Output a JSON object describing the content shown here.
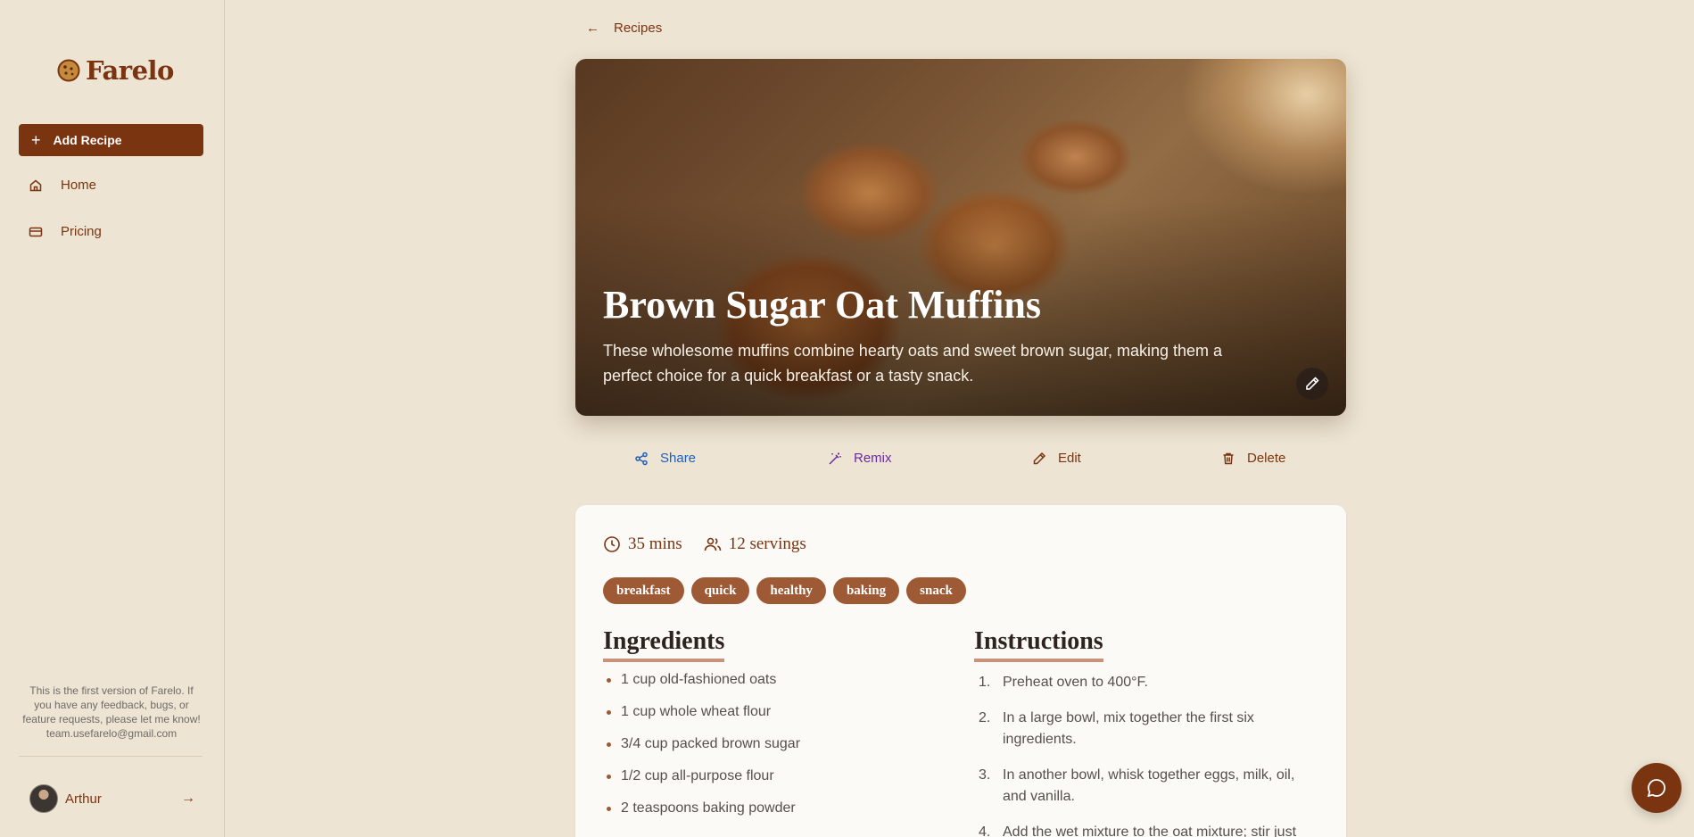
{
  "app": {
    "name": "Farelo"
  },
  "sidebar": {
    "add_recipe_label": "Add Recipe",
    "items": [
      {
        "label": "Home",
        "icon": "home-icon"
      },
      {
        "label": "Pricing",
        "icon": "credit-card-icon"
      }
    ],
    "feedback_text": "This is the first version of Farelo. If you have any feedback, bugs, or feature requests, please let me know! team.usefarelo@gmail.com",
    "user": {
      "name": "Arthur"
    }
  },
  "breadcrumb": {
    "back_label": "Recipes"
  },
  "recipe": {
    "title": "Brown Sugar Oat Muffins",
    "description": "These wholesome muffins combine hearty oats and sweet brown sugar, making them a perfect choice for a quick breakfast or a tasty snack.",
    "time": "35 mins",
    "servings": "12 servings",
    "tags": [
      "breakfast",
      "quick",
      "healthy",
      "baking",
      "snack"
    ],
    "ingredients_heading": "Ingredients",
    "instructions_heading": "Instructions",
    "ingredients": [
      "1 cup old-fashioned oats",
      "1 cup whole wheat flour",
      "3/4 cup packed brown sugar",
      "1/2 cup all-purpose flour",
      "2 teaspoons baking powder"
    ],
    "instructions": [
      {
        "num": "1.",
        "text": "Preheat oven to 400°F."
      },
      {
        "num": "2.",
        "text": "In a large bowl, mix together the first six ingredients."
      },
      {
        "num": "3.",
        "text": "In another bowl, whisk together eggs, milk, oil, and vanilla."
      },
      {
        "num": "4.",
        "text": "Add the wet mixture to the oat mixture; stir just"
      }
    ]
  },
  "actions": {
    "share": "Share",
    "remix": "Remix",
    "edit": "Edit",
    "delete": "Delete"
  },
  "colors": {
    "brand": "#7a3510",
    "background": "#ede4d3",
    "tag": "#9d5a35",
    "share": "#1f5fb8",
    "remix": "#6a2aa3"
  }
}
